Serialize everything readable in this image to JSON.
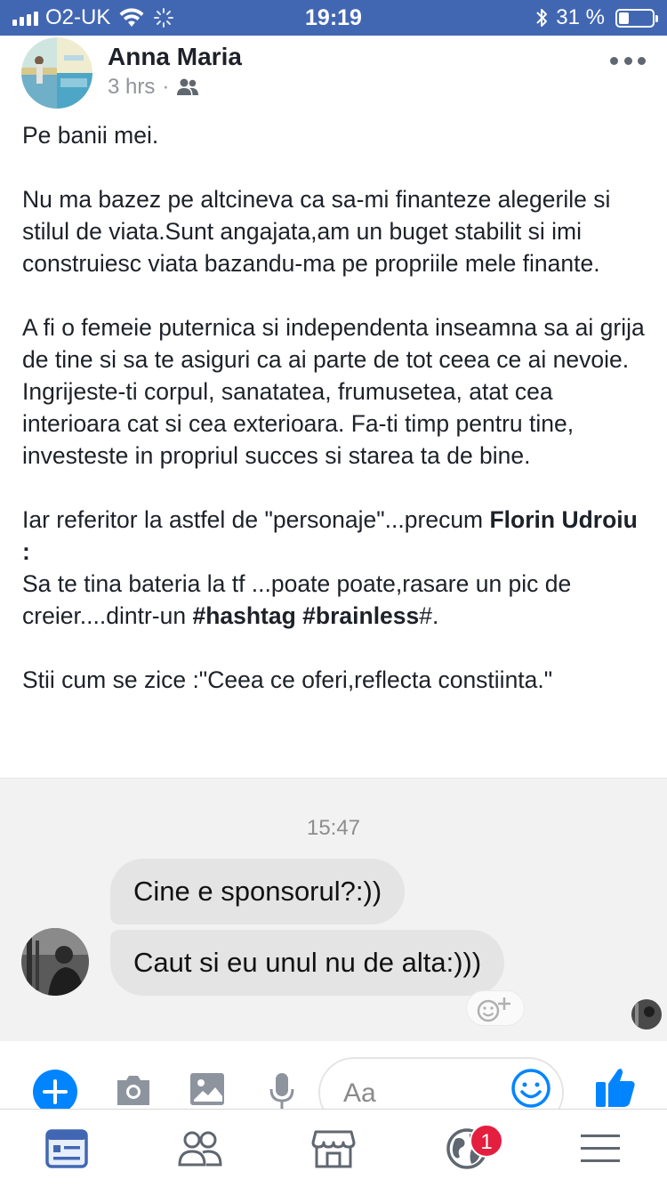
{
  "status_bar": {
    "carrier": "O2-UK",
    "time": "19:19",
    "battery_text": "31 %",
    "battery_level": 0.31,
    "signal_bars": 4
  },
  "post": {
    "author": "Anna Maria",
    "time_ago": "3 hrs",
    "separator": "·",
    "audience_icon": "friends-icon",
    "paragraphs": {
      "p1": "Pe banii mei.",
      "p2": "Nu ma bazez pe altcineva ca sa-mi finanteze alegerile si stilul de viata.Sunt angajata,am un buget stabilit si imi construiesc viata bazandu-ma pe propriile mele finante.",
      "p3": "A fi o femeie puternica si independenta inseamna sa ai grija de tine si sa te asiguri ca ai parte de tot ceea ce ai nevoie. Ingrijeste-ti corpul, sanatatea, frumusetea, atat cea interioara cat si cea exterioara. Fa-ti timp pentru tine, investeste in propriul succes si starea ta de bine.",
      "p4_pre": "Iar referitor la astfel de \"personaje\"...precum ",
      "p4_mention": "Florin Udroiu",
      "p4_post": " :",
      "p5_pre": "Sa te tina bateria la tf ...poate poate,rasare un pic de creier....dintr-un ",
      "p5_tags": "#hashtag #brainless",
      "p5_post": "#.",
      "p6": "Stii cum se zice :\"Ceea ce oferi,reflecta constiinta.\""
    }
  },
  "chat_screenshot": {
    "timestamp": "15:47",
    "messages": [
      "Cine e sponsorul?:))",
      "Caut si eu unul nu de alta:)))"
    ],
    "composer_placeholder": "Aa"
  },
  "tab_bar": {
    "tabs": [
      "news-feed-icon",
      "friends-icon",
      "marketplace-icon",
      "notifications-globe-icon",
      "menu-icon"
    ],
    "notification_badge": "1"
  },
  "colors": {
    "status_bar": "#4267b2",
    "facebook_blue": "#4267b2",
    "messenger_blue": "#0084ff",
    "badge_red": "#e41e3f"
  }
}
